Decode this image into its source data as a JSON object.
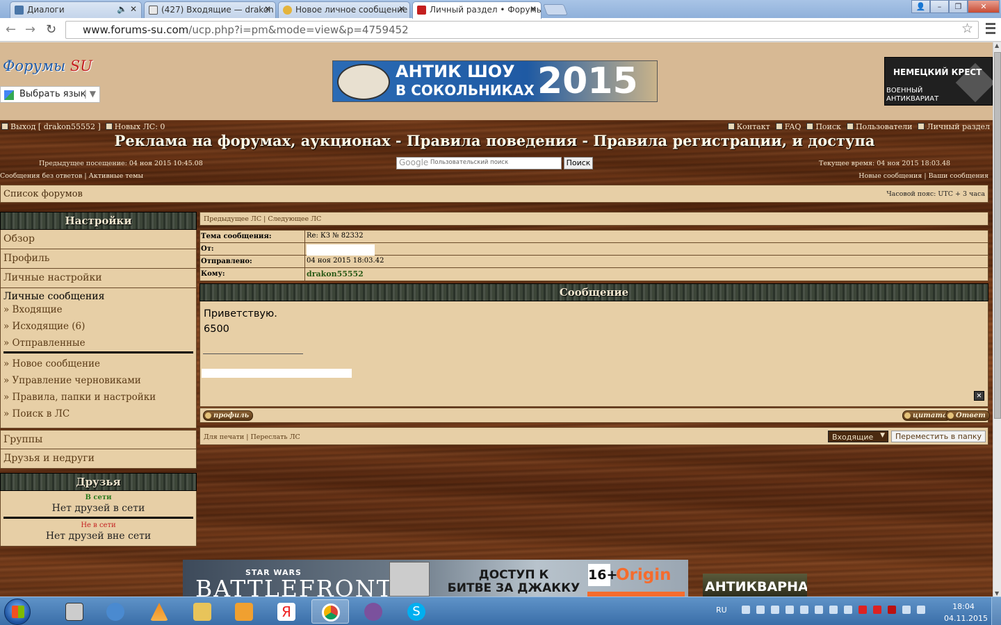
{
  "browser": {
    "tabs": [
      {
        "label": "Диалоги",
        "icon": "vk-icon",
        "icon_color": "#4a76a8"
      },
      {
        "label": "(427) Входящие — drakon",
        "icon": "mail-icon",
        "icon_color": "#e8e8e8"
      },
      {
        "label": "Новое личное сообщение",
        "icon": "forum-icon",
        "icon_color": "#e4b43c"
      },
      {
        "label": "Личный раздел • Форумы",
        "icon": "forum-su-icon",
        "icon_color": "#c41f1f"
      }
    ],
    "url_host": "www.forums-su.com",
    "url_path": "/ucp.php?i=pm&mode=view&p=4759452"
  },
  "header": {
    "logo_main": "Форумы ",
    "logo_accent": "SU",
    "translate_label": "Выбрать язык",
    "banner1": {
      "title_line1": "АНТИК ШОУ",
      "title_line2": "В СОКОЛЬНИКАХ",
      "year": "2015"
    },
    "banner2": {
      "title": "НЕМЕЦКИЙ КРЕСТ",
      "subtitle": "ВОЕННЫЙ АНТИКВАРИАТ"
    }
  },
  "toplinks": {
    "logout": "Выход [ drakon55552 ]",
    "new_pm": "Новых ЛС: 0",
    "contact": "Контакт",
    "faq": "FAQ",
    "search": "Поиск",
    "users": "Пользователи",
    "personal": "Личный раздел"
  },
  "site_title": "Реклама на форумах, аукционах - Правила поведения - Правила регистрации, и доступа",
  "last_visit": "Предыдущее посещение: 04 ноя 2015 10:45.08",
  "current_time": "Текущее время: 04 ноя 2015 18:03.48",
  "google_search": {
    "logo": "Google",
    "placeholder": "Пользовательский поиск",
    "button": "Поиск"
  },
  "sublinks": {
    "left": "Сообщения без ответов | Активные темы",
    "right": "Новые сообщения | Ваши сообщения"
  },
  "breadcrumb": {
    "label": "Список форумов",
    "timezone": "Часовой пояс: UTC + 3 часа"
  },
  "sidebar": {
    "settings_title": "Настройки",
    "items_top": [
      "Обзор",
      "Профиль",
      "Личные настройки"
    ],
    "pm_title": "Личные сообщения",
    "pm_folders": [
      "» Входящие",
      "» Исходящие (6)",
      "» Отправленные"
    ],
    "pm_actions": [
      "» Новое сообщение",
      "» Управление черновиками",
      "» Правила, папки и настройки",
      "» Поиск в ЛС"
    ],
    "items_bottom": [
      "Группы",
      "Друзья и недруги"
    ],
    "friends_title": "Друзья",
    "online_label": "В сети",
    "no_online": "Нет друзей в сети",
    "offline_label": "Не в сети",
    "no_offline": "Нет друзей вне сети"
  },
  "message": {
    "nav": "Предыдущее ЛС | Следующее ЛС",
    "subject_label": "Тема сообщения:",
    "subject": "Re: КЗ № 82332",
    "from_label": "От:",
    "sent_label": "Отправлено:",
    "sent": "04 ноя 2015 18:03.42",
    "to_label": "Кому:",
    "to": "drakon55552",
    "section_title": "Сообщение",
    "body_line1": "Приветствую.",
    "body_line2": "6500",
    "profile_button": "профиль",
    "quote_button": "цитата",
    "reply_button": "Ответ",
    "actions_left": "Для печати | Переслать ЛС",
    "folder_select": "Входящие",
    "move_button": "Переместить в папку"
  },
  "ads": {
    "bottom1": {
      "brand": "STAR WARS",
      "title": "BATTLEFRONT",
      "text_line1": "ДОСТУП К",
      "text_line2": "БИТВЕ ЗА ДЖАККУ",
      "age": "16+",
      "store": "Origin"
    },
    "bottom2": {
      "title": "АНТИКВАРНАЯ"
    }
  },
  "taskbar": {
    "lang": "RU",
    "time": "18:04",
    "date": "04.11.2015",
    "apps": [
      "explorer-icon",
      "thunderbird-icon",
      "vlc-icon",
      "folder-icon",
      "media-player-icon",
      "yandex-icon",
      "chrome-icon",
      "viber-icon",
      "skype-icon"
    ]
  },
  "colors": {
    "panel": "#e7cfa6",
    "header_bg": "#d7b994",
    "wood": "#6b3a1e",
    "link": "#5a3a16",
    "online": "#2a7a1e",
    "offline": "#c41f1f"
  }
}
